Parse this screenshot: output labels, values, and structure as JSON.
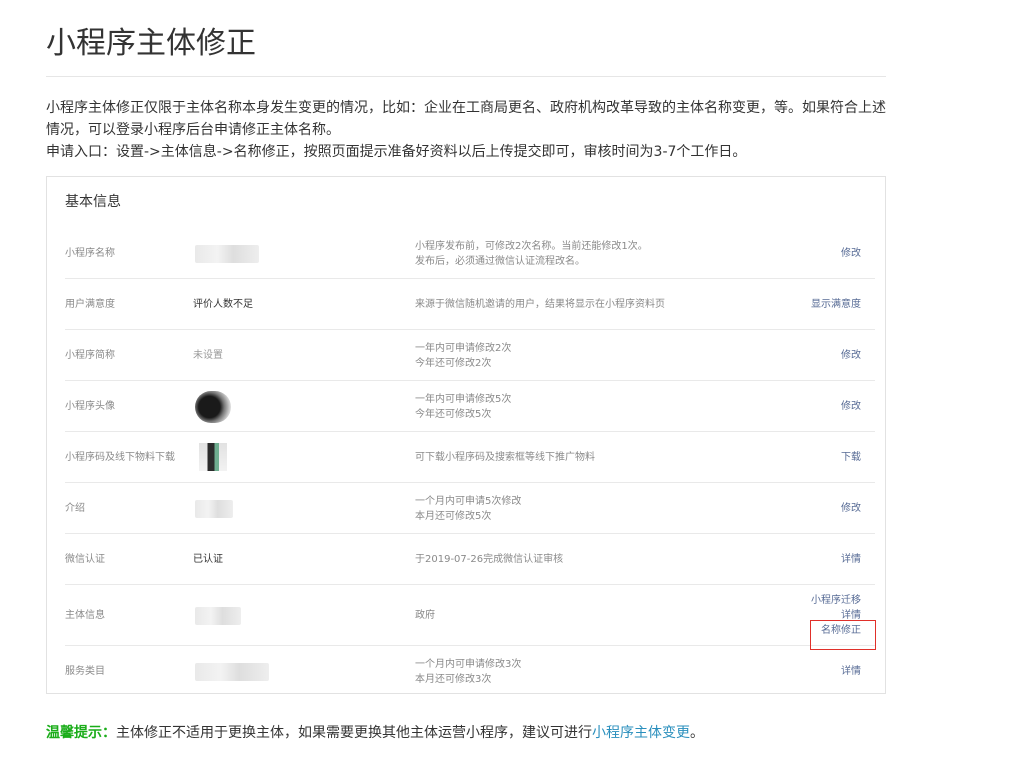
{
  "page_title": "小程序主体修正",
  "intro": {
    "line1": "小程序主体修正仅限于主体名称本身发生变更的情况，比如：企业在工商局更名、政府机构改革导致的主体名称变更，等。如果符合上述情况，可以登录小程序后台申请修正主体名称。",
    "line2": "申请入口：设置->主体信息->名称修正，按照页面提示准备好资料以后上传提交即可，审核时间为3-7个工作日。"
  },
  "card": {
    "title": "基本信息",
    "rows": [
      {
        "label": "小程序名称",
        "value": "",
        "desc1": "小程序发布前，可修改2次名称。当前还能修改1次。",
        "desc2": "发布后，必须通过微信认证流程改名。",
        "action": "修改"
      },
      {
        "label": "用户满意度",
        "value": "评价人数不足",
        "desc1": "来源于微信随机邀请的用户，结果将显示在小程序资料页",
        "desc2": "",
        "action": "显示满意度"
      },
      {
        "label": "小程序简称",
        "value": "未设置",
        "desc1": "一年内可申请修改2次",
        "desc2": "今年还可修改2次",
        "action": "修改"
      },
      {
        "label": "小程序头像",
        "value": "",
        "desc1": "一年内可申请修改5次",
        "desc2": "今年还可修改5次",
        "action": "修改"
      },
      {
        "label": "小程序码及线下物料下载",
        "value": "",
        "desc1": "可下载小程序码及搜索框等线下推广物料",
        "desc2": "",
        "action": "下载"
      },
      {
        "label": "介绍",
        "value": "",
        "desc1": "一个月内可申请5次修改",
        "desc2": "本月还可修改5次",
        "action": "修改"
      },
      {
        "label": "微信认证",
        "value": "已认证",
        "desc1": "于2019-07-26完成微信认证审核",
        "desc2": "",
        "action": "详情"
      },
      {
        "label": "主体信息",
        "value": "",
        "desc1": "政府",
        "desc2": "",
        "actions": [
          "小程序迁移",
          "详情",
          "名称修正"
        ]
      },
      {
        "label": "服务类目",
        "value": "",
        "desc1": "一个月内可申请修改3次",
        "desc2": "本月还可修改3次",
        "action": "详情"
      }
    ]
  },
  "tip": {
    "label": "温馨提示：",
    "text": "主体修正不适用于更换主体，如果需要更换其他主体运营小程序，建议可进行",
    "link": "小程序主体变更",
    "end": "。"
  },
  "colors": {
    "link": "#576b95",
    "highlight_border": "#e0302a",
    "tip_label": "#1aad19",
    "tip_link": "#2a8fbd"
  }
}
